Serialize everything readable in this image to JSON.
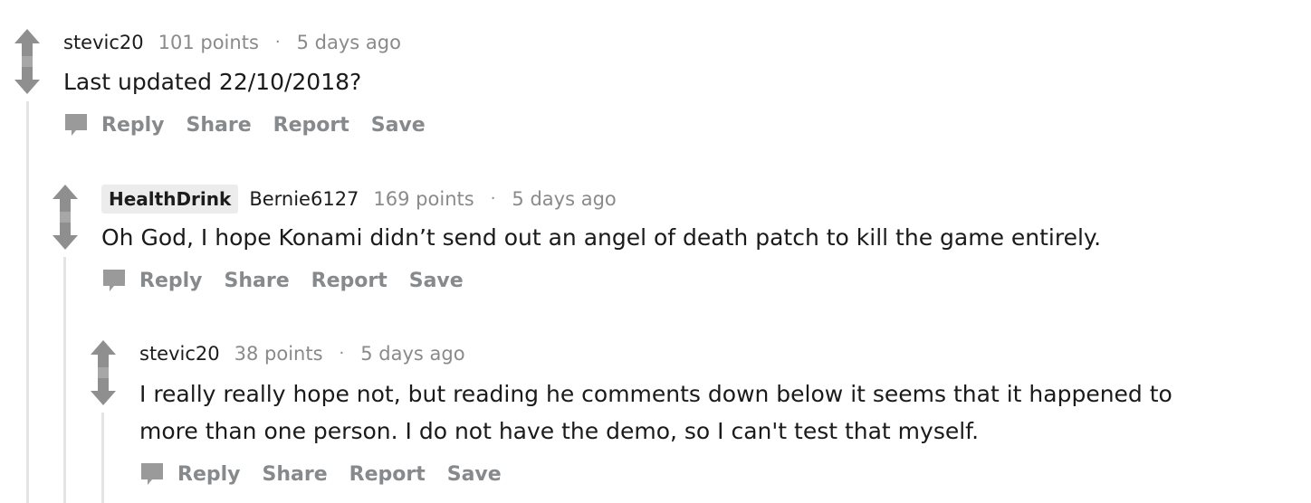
{
  "comments": [
    {
      "author": "stevic20",
      "flair": "",
      "points": "101 points",
      "separator": "·",
      "time": "5 days ago",
      "body": [
        "Last updated 22/10/2018?"
      ],
      "actions": {
        "reply": "Reply",
        "share": "Share",
        "report": "Report",
        "save": "Save"
      }
    },
    {
      "author": "Bernie6127",
      "flair": "HealthDrink",
      "points": "169 points",
      "separator": "·",
      "time": "5 days ago",
      "body": [
        "Oh God, I hope Konami didn’t send out an angel of death patch to kill the game entirely."
      ],
      "actions": {
        "reply": "Reply",
        "share": "Share",
        "report": "Report",
        "save": "Save"
      }
    },
    {
      "author": "stevic20",
      "flair": "",
      "points": "38 points",
      "separator": "·",
      "time": "5 days ago",
      "body": [
        "I really really hope not, but reading he comments down below it seems that it happened to",
        "more than one person. I do not have the demo, so I can't test that myself."
      ],
      "actions": {
        "reply": "Reply",
        "share": "Share",
        "report": "Report",
        "save": "Save"
      }
    }
  ],
  "icons": {
    "vote": "upvote-downvote-arrows",
    "reply": "comment-bubble-icon"
  },
  "colors": {
    "author": "#1c1c1c",
    "meta": "#8a8a8a",
    "action": "#878a8c",
    "vote_arrow": "#8f8f8f",
    "thread_line": "#e4e4e4",
    "flair_bg": "#ececec"
  }
}
